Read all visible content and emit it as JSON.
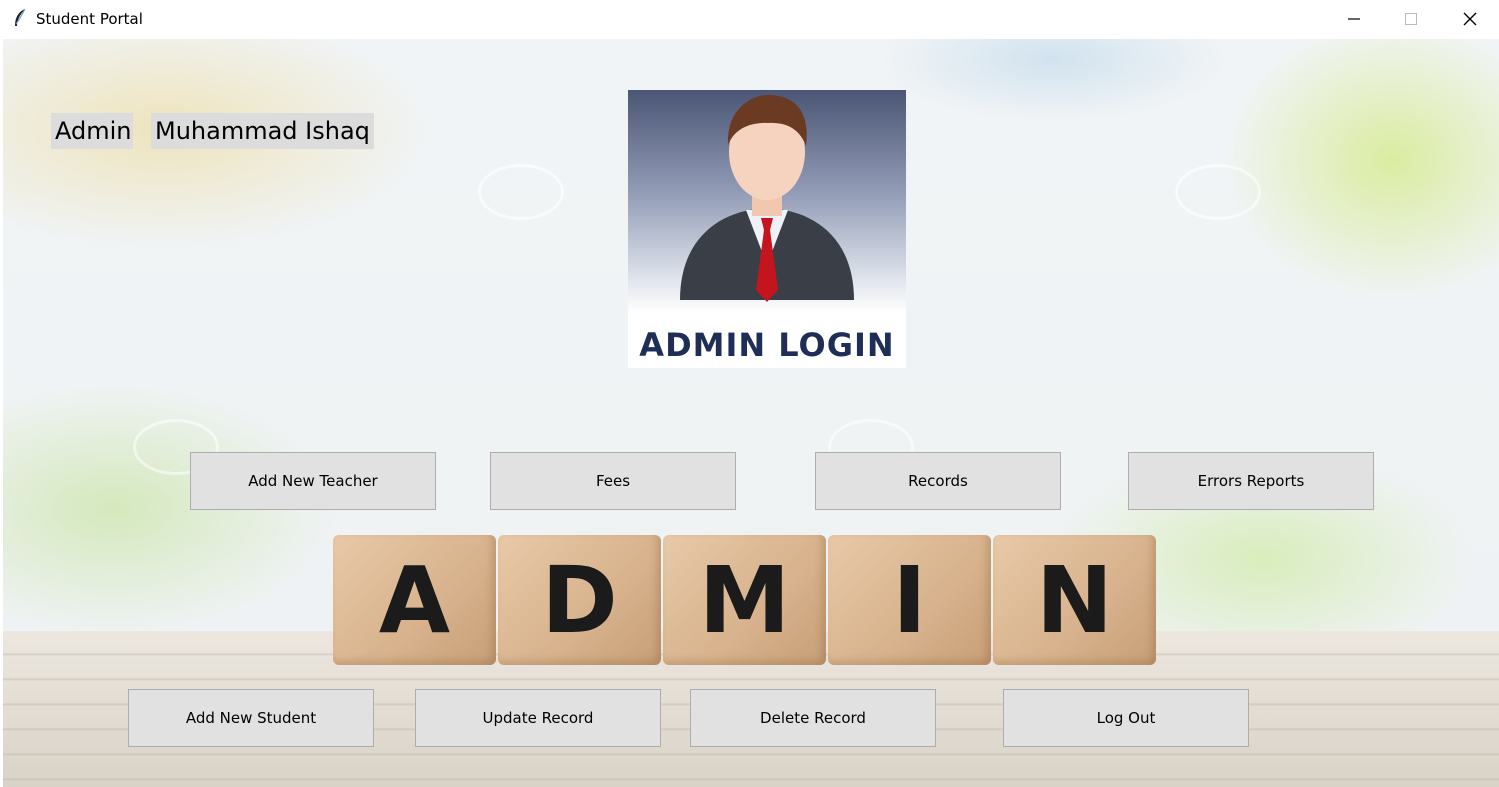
{
  "window": {
    "title": "Student Portal",
    "controls": {
      "minimize_icon": "minimize-icon",
      "maximize_icon": "maximize-icon",
      "close_icon": "close-icon"
    }
  },
  "header": {
    "role_label": "Admin",
    "user_name": "Muhammad Ishaq"
  },
  "login_image": {
    "icon": "admin-avatar-icon",
    "caption": "ADMIN LOGIN"
  },
  "top_buttons": [
    {
      "label": "Add New Teacher"
    },
    {
      "label": "Fees"
    },
    {
      "label": "Records"
    },
    {
      "label": "Errors Reports"
    }
  ],
  "bottom_buttons": [
    {
      "label": "Add New Student"
    },
    {
      "label": "Update Record"
    },
    {
      "label": "Delete Record"
    },
    {
      "label": "Log Out"
    }
  ],
  "blocks": [
    "A",
    "D",
    "M",
    "I",
    "N"
  ],
  "colors": {
    "button_bg": "#e1e1e1",
    "label_bg": "#dcdcdc",
    "login_text": "#1e2e57"
  }
}
